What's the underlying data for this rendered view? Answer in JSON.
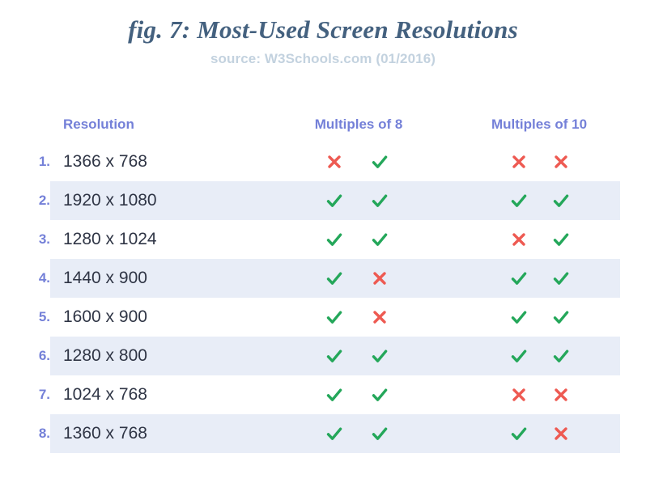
{
  "header": {
    "title": "fig. 7: Most-Used Screen Resolutions",
    "subtitle": "source: W3Schools.com (01/2016)"
  },
  "colors": {
    "title": "#44617f",
    "subtitle": "#c3d2df",
    "accent_header": "#7480d8",
    "index": "#7480d8",
    "resolution_text": "#2f3545",
    "stripe": "#e8edf7",
    "check": "#24a75a",
    "cross": "#ee5a52",
    "background": "#ffffff"
  },
  "table": {
    "columns": {
      "resolution": "Resolution",
      "multiples_of_8": "Multiples of 8",
      "multiples_of_10": "Multiples of 10"
    },
    "rows": [
      {
        "index": "1.",
        "resolution": "1366 x 768",
        "m8_width": "cross-icon",
        "m8_height": "check-icon",
        "m10_width": "cross-icon",
        "m10_height": "cross-icon"
      },
      {
        "index": "2.",
        "resolution": "1920 x 1080",
        "m8_width": "check-icon",
        "m8_height": "check-icon",
        "m10_width": "check-icon",
        "m10_height": "check-icon"
      },
      {
        "index": "3.",
        "resolution": "1280 x 1024",
        "m8_width": "check-icon",
        "m8_height": "check-icon",
        "m10_width": "cross-icon",
        "m10_height": "check-icon"
      },
      {
        "index": "4.",
        "resolution": "1440 x 900",
        "m8_width": "check-icon",
        "m8_height": "cross-icon",
        "m10_width": "check-icon",
        "m10_height": "check-icon"
      },
      {
        "index": "5.",
        "resolution": "1600 x 900",
        "m8_width": "check-icon",
        "m8_height": "cross-icon",
        "m10_width": "check-icon",
        "m10_height": "check-icon"
      },
      {
        "index": "6.",
        "resolution": "1280 x 800",
        "m8_width": "check-icon",
        "m8_height": "check-icon",
        "m10_width": "check-icon",
        "m10_height": "check-icon"
      },
      {
        "index": "7.",
        "resolution": "1024 x 768",
        "m8_width": "check-icon",
        "m8_height": "check-icon",
        "m10_width": "cross-icon",
        "m10_height": "cross-icon"
      },
      {
        "index": "8.",
        "resolution": "1360 x 768",
        "m8_width": "check-icon",
        "m8_height": "check-icon",
        "m10_width": "check-icon",
        "m10_height": "cross-icon"
      }
    ]
  },
  "chart_data": {
    "type": "table",
    "title": "fig. 7: Most-Used Screen Resolutions",
    "subtitle": "source: W3Schools.com (01/2016)",
    "columns": [
      "#",
      "Resolution",
      "Multiples of 8 (width)",
      "Multiples of 8 (height)",
      "Multiples of 10 (width)",
      "Multiples of 10 (height)"
    ],
    "rows": [
      [
        "1.",
        "1366 x 768",
        false,
        true,
        false,
        false
      ],
      [
        "2.",
        "1920 x 1080",
        true,
        true,
        true,
        true
      ],
      [
        "3.",
        "1280 x 1024",
        true,
        true,
        false,
        true
      ],
      [
        "4.",
        "1440 x 900",
        true,
        false,
        true,
        true
      ],
      [
        "5.",
        "1600 x 900",
        true,
        false,
        true,
        true
      ],
      [
        "6.",
        "1280 x 800",
        true,
        true,
        true,
        true
      ],
      [
        "7.",
        "1024 x 768",
        true,
        true,
        false,
        false
      ],
      [
        "8.",
        "1360 x 768",
        true,
        true,
        true,
        false
      ]
    ]
  }
}
